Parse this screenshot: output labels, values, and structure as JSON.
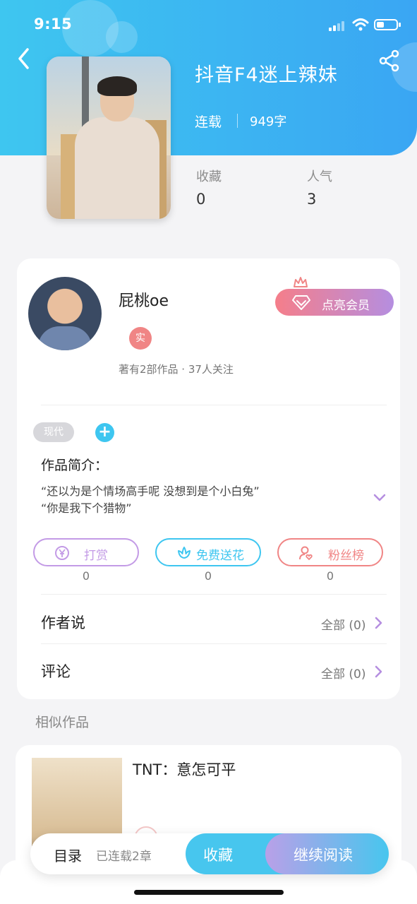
{
  "status_bar": {
    "time": "9:15"
  },
  "book": {
    "title": "抖音F4迷上辣妹",
    "status": "连载",
    "word_count": "949字",
    "stats": [
      {
        "label": "收藏",
        "value": "0"
      },
      {
        "label": "人气",
        "value": "3"
      }
    ]
  },
  "author": {
    "name": "屁桃oe",
    "real_badge": "实",
    "summary": "著有2部作品 · 37人关注",
    "vip_label": "点亮会员"
  },
  "tags": [
    "现代"
  ],
  "add_tag_symbol": "+",
  "intro": {
    "title": "作品简介：",
    "lines": [
      "“还以为是个情场高手呢 没想到是个小白兔”",
      "“你是我下个猎物”"
    ]
  },
  "actions": [
    {
      "label": "打赏",
      "count": "0",
      "color": "#c39be6"
    },
    {
      "label": "免费送花",
      "count": "0",
      "color": "#3ec6f0"
    },
    {
      "label": "粉丝榜",
      "count": "0",
      "color": "#f08585"
    }
  ],
  "rows": [
    {
      "title": "作者说",
      "right": "全部 (0)"
    },
    {
      "title": "评论",
      "right": "全部 (0)"
    }
  ],
  "similar": {
    "section_title": "相似作品",
    "items": [
      {
        "title": "TNT：意怎可平"
      }
    ]
  },
  "bottom_bar": {
    "toc_label": "目录",
    "toc_count": "已连载2章",
    "favorite_label": "收藏",
    "read_label": "继续阅读"
  },
  "colors": {
    "header_start": "#3ec6f0",
    "header_end": "#3aa6f3",
    "accent_purple": "#b58ee0",
    "accent_pink": "#f57e8a"
  }
}
